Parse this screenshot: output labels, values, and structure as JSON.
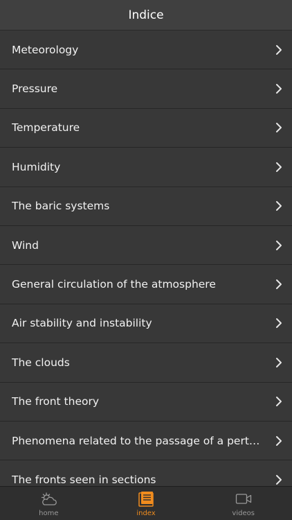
{
  "navbar": {
    "title": "Indice"
  },
  "list": {
    "items": [
      {
        "label": "Meteorology"
      },
      {
        "label": "Pressure"
      },
      {
        "label": "Temperature"
      },
      {
        "label": "Humidity"
      },
      {
        "label": "The baric systems"
      },
      {
        "label": "Wind"
      },
      {
        "label": "General circulation of the atmosphere"
      },
      {
        "label": "Air stability and instability"
      },
      {
        "label": "The clouds"
      },
      {
        "label": "The front theory"
      },
      {
        "label": "Phenomena related to the passage of a pertu…"
      },
      {
        "label": "The fronts seen in sections"
      }
    ],
    "chevron_icon": "chevron-right-icon"
  },
  "tabbar": {
    "tabs": [
      {
        "label": "home",
        "icon": "weather-sun-cloud-icon",
        "active": false
      },
      {
        "label": "index",
        "icon": "document-index-icon",
        "active": true
      },
      {
        "label": "videos",
        "icon": "video-camera-icon",
        "active": false
      }
    ]
  },
  "colors": {
    "accent": "#f08c1e",
    "background": "#383838",
    "navbar": "#404040",
    "tabbar": "#2f2f2f",
    "inactive_tab": "#9a9a9a"
  }
}
